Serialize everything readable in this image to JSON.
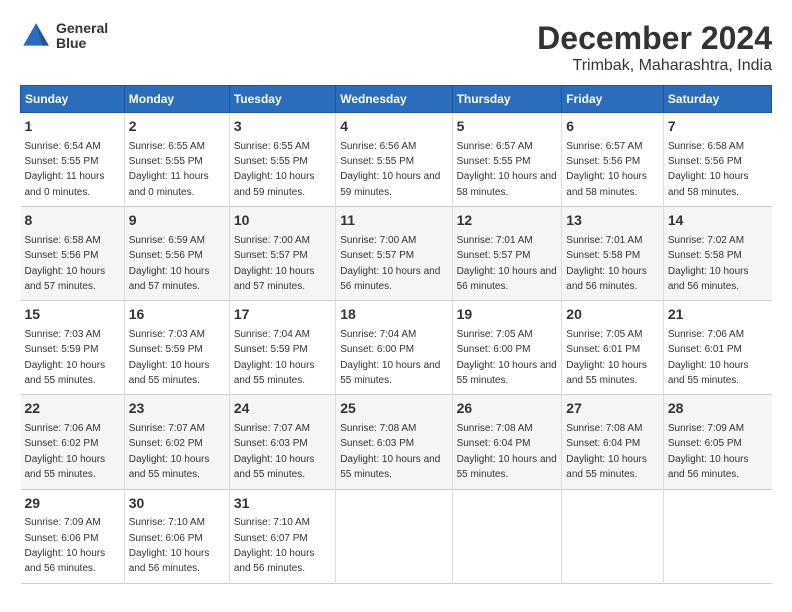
{
  "header": {
    "logo": {
      "line1": "General",
      "line2": "Blue"
    },
    "title": "December 2024",
    "subtitle": "Trimbak, Maharashtra, India"
  },
  "days_of_week": [
    "Sunday",
    "Monday",
    "Tuesday",
    "Wednesday",
    "Thursday",
    "Friday",
    "Saturday"
  ],
  "weeks": [
    [
      {
        "day": "1",
        "sunrise": "Sunrise: 6:54 AM",
        "sunset": "Sunset: 5:55 PM",
        "daylight": "Daylight: 11 hours and 0 minutes."
      },
      {
        "day": "2",
        "sunrise": "Sunrise: 6:55 AM",
        "sunset": "Sunset: 5:55 PM",
        "daylight": "Daylight: 11 hours and 0 minutes."
      },
      {
        "day": "3",
        "sunrise": "Sunrise: 6:55 AM",
        "sunset": "Sunset: 5:55 PM",
        "daylight": "Daylight: 10 hours and 59 minutes."
      },
      {
        "day": "4",
        "sunrise": "Sunrise: 6:56 AM",
        "sunset": "Sunset: 5:55 PM",
        "daylight": "Daylight: 10 hours and 59 minutes."
      },
      {
        "day": "5",
        "sunrise": "Sunrise: 6:57 AM",
        "sunset": "Sunset: 5:55 PM",
        "daylight": "Daylight: 10 hours and 58 minutes."
      },
      {
        "day": "6",
        "sunrise": "Sunrise: 6:57 AM",
        "sunset": "Sunset: 5:56 PM",
        "daylight": "Daylight: 10 hours and 58 minutes."
      },
      {
        "day": "7",
        "sunrise": "Sunrise: 6:58 AM",
        "sunset": "Sunset: 5:56 PM",
        "daylight": "Daylight: 10 hours and 58 minutes."
      }
    ],
    [
      {
        "day": "8",
        "sunrise": "Sunrise: 6:58 AM",
        "sunset": "Sunset: 5:56 PM",
        "daylight": "Daylight: 10 hours and 57 minutes."
      },
      {
        "day": "9",
        "sunrise": "Sunrise: 6:59 AM",
        "sunset": "Sunset: 5:56 PM",
        "daylight": "Daylight: 10 hours and 57 minutes."
      },
      {
        "day": "10",
        "sunrise": "Sunrise: 7:00 AM",
        "sunset": "Sunset: 5:57 PM",
        "daylight": "Daylight: 10 hours and 57 minutes."
      },
      {
        "day": "11",
        "sunrise": "Sunrise: 7:00 AM",
        "sunset": "Sunset: 5:57 PM",
        "daylight": "Daylight: 10 hours and 56 minutes."
      },
      {
        "day": "12",
        "sunrise": "Sunrise: 7:01 AM",
        "sunset": "Sunset: 5:57 PM",
        "daylight": "Daylight: 10 hours and 56 minutes."
      },
      {
        "day": "13",
        "sunrise": "Sunrise: 7:01 AM",
        "sunset": "Sunset: 5:58 PM",
        "daylight": "Daylight: 10 hours and 56 minutes."
      },
      {
        "day": "14",
        "sunrise": "Sunrise: 7:02 AM",
        "sunset": "Sunset: 5:58 PM",
        "daylight": "Daylight: 10 hours and 56 minutes."
      }
    ],
    [
      {
        "day": "15",
        "sunrise": "Sunrise: 7:03 AM",
        "sunset": "Sunset: 5:59 PM",
        "daylight": "Daylight: 10 hours and 55 minutes."
      },
      {
        "day": "16",
        "sunrise": "Sunrise: 7:03 AM",
        "sunset": "Sunset: 5:59 PM",
        "daylight": "Daylight: 10 hours and 55 minutes."
      },
      {
        "day": "17",
        "sunrise": "Sunrise: 7:04 AM",
        "sunset": "Sunset: 5:59 PM",
        "daylight": "Daylight: 10 hours and 55 minutes."
      },
      {
        "day": "18",
        "sunrise": "Sunrise: 7:04 AM",
        "sunset": "Sunset: 6:00 PM",
        "daylight": "Daylight: 10 hours and 55 minutes."
      },
      {
        "day": "19",
        "sunrise": "Sunrise: 7:05 AM",
        "sunset": "Sunset: 6:00 PM",
        "daylight": "Daylight: 10 hours and 55 minutes."
      },
      {
        "day": "20",
        "sunrise": "Sunrise: 7:05 AM",
        "sunset": "Sunset: 6:01 PM",
        "daylight": "Daylight: 10 hours and 55 minutes."
      },
      {
        "day": "21",
        "sunrise": "Sunrise: 7:06 AM",
        "sunset": "Sunset: 6:01 PM",
        "daylight": "Daylight: 10 hours and 55 minutes."
      }
    ],
    [
      {
        "day": "22",
        "sunrise": "Sunrise: 7:06 AM",
        "sunset": "Sunset: 6:02 PM",
        "daylight": "Daylight: 10 hours and 55 minutes."
      },
      {
        "day": "23",
        "sunrise": "Sunrise: 7:07 AM",
        "sunset": "Sunset: 6:02 PM",
        "daylight": "Daylight: 10 hours and 55 minutes."
      },
      {
        "day": "24",
        "sunrise": "Sunrise: 7:07 AM",
        "sunset": "Sunset: 6:03 PM",
        "daylight": "Daylight: 10 hours and 55 minutes."
      },
      {
        "day": "25",
        "sunrise": "Sunrise: 7:08 AM",
        "sunset": "Sunset: 6:03 PM",
        "daylight": "Daylight: 10 hours and 55 minutes."
      },
      {
        "day": "26",
        "sunrise": "Sunrise: 7:08 AM",
        "sunset": "Sunset: 6:04 PM",
        "daylight": "Daylight: 10 hours and 55 minutes."
      },
      {
        "day": "27",
        "sunrise": "Sunrise: 7:08 AM",
        "sunset": "Sunset: 6:04 PM",
        "daylight": "Daylight: 10 hours and 55 minutes."
      },
      {
        "day": "28",
        "sunrise": "Sunrise: 7:09 AM",
        "sunset": "Sunset: 6:05 PM",
        "daylight": "Daylight: 10 hours and 56 minutes."
      }
    ],
    [
      {
        "day": "29",
        "sunrise": "Sunrise: 7:09 AM",
        "sunset": "Sunset: 6:06 PM",
        "daylight": "Daylight: 10 hours and 56 minutes."
      },
      {
        "day": "30",
        "sunrise": "Sunrise: 7:10 AM",
        "sunset": "Sunset: 6:06 PM",
        "daylight": "Daylight: 10 hours and 56 minutes."
      },
      {
        "day": "31",
        "sunrise": "Sunrise: 7:10 AM",
        "sunset": "Sunset: 6:07 PM",
        "daylight": "Daylight: 10 hours and 56 minutes."
      },
      null,
      null,
      null,
      null
    ]
  ]
}
